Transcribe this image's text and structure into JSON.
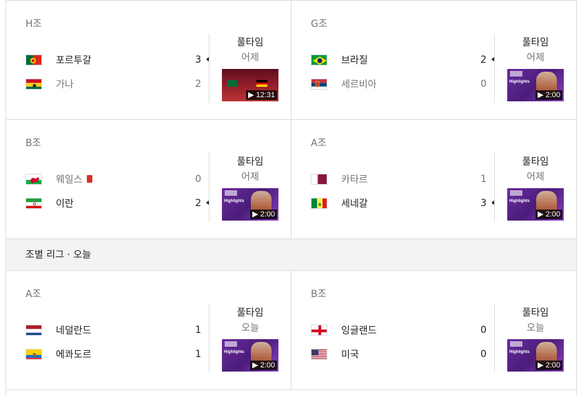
{
  "section_header": "조별 리그 · 오늘",
  "cards": [
    {
      "group": "H조",
      "status": "풀타임",
      "when": "어제",
      "duration": "▶ 12:31",
      "thumb": "pt",
      "teams": [
        {
          "name": "포르투갈",
          "score": "3",
          "winner": true,
          "flag": "portugal-flag"
        },
        {
          "name": "가나",
          "score": "2",
          "winner": false,
          "flag": "ghana-flag"
        }
      ]
    },
    {
      "group": "G조",
      "status": "풀타임",
      "when": "어제",
      "duration": "▶ 2:00",
      "thumb": "hl",
      "teams": [
        {
          "name": "브라질",
          "score": "2",
          "winner": true,
          "flag": "brazil-flag"
        },
        {
          "name": "세르비아",
          "score": "0",
          "winner": false,
          "flag": "serbia-flag"
        }
      ]
    },
    {
      "group": "B조",
      "status": "풀타임",
      "when": "어제",
      "duration": "▶ 2:00",
      "thumb": "hl",
      "teams": [
        {
          "name": "웨일스",
          "score": "0",
          "winner": false,
          "flag": "wales-flag",
          "redcard": true
        },
        {
          "name": "이란",
          "score": "2",
          "winner": true,
          "flag": "iran-flag"
        }
      ]
    },
    {
      "group": "A조",
      "status": "풀타임",
      "when": "어제",
      "duration": "▶ 2:00",
      "thumb": "hl",
      "teams": [
        {
          "name": "카타르",
          "score": "1",
          "winner": false,
          "flag": "qatar-flag"
        },
        {
          "name": "세네갈",
          "score": "3",
          "winner": true,
          "flag": "senegal-flag"
        }
      ]
    },
    {
      "group": "A조",
      "status": "풀타임",
      "when": "오늘",
      "duration": "▶ 2:00",
      "thumb": "hl",
      "teams": [
        {
          "name": "네덜란드",
          "score": "1",
          "winner": null,
          "flag": "netherlands-flag"
        },
        {
          "name": "에콰도르",
          "score": "1",
          "winner": null,
          "flag": "ecuador-flag"
        }
      ]
    },
    {
      "group": "B조",
      "status": "풀타임",
      "when": "오늘",
      "duration": "▶ 2:00",
      "thumb": "hl",
      "teams": [
        {
          "name": "잉글랜드",
          "score": "0",
          "winner": null,
          "flag": "england-flag"
        },
        {
          "name": "미국",
          "score": "0",
          "winner": null,
          "flag": "usa-flag"
        }
      ]
    }
  ],
  "thumb_label": "Highlights"
}
